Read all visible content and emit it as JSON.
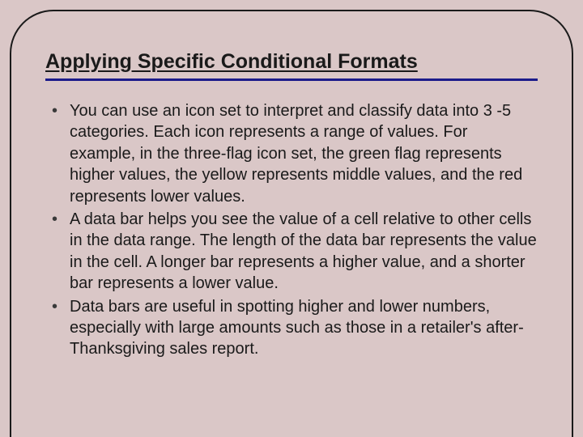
{
  "title": "Applying Specific Conditional Formats",
  "bullets": [
    "You can use an icon set to interpret and classify data into 3 -5 categories. Each icon represents a range of values. For example, in the three-flag icon set, the green flag represents higher values, the yellow represents middle values, and the red represents lower values.",
    "A data bar helps you see the value of a cell relative to other cells in the data range. The length of the data bar represents the value in the cell. A longer bar represents a higher value, and a shorter bar represents a lower value.",
    "Data bars are useful in spotting higher and lower numbers, especially with large amounts such as those in a retailer's after-Thanksgiving sales report."
  ]
}
